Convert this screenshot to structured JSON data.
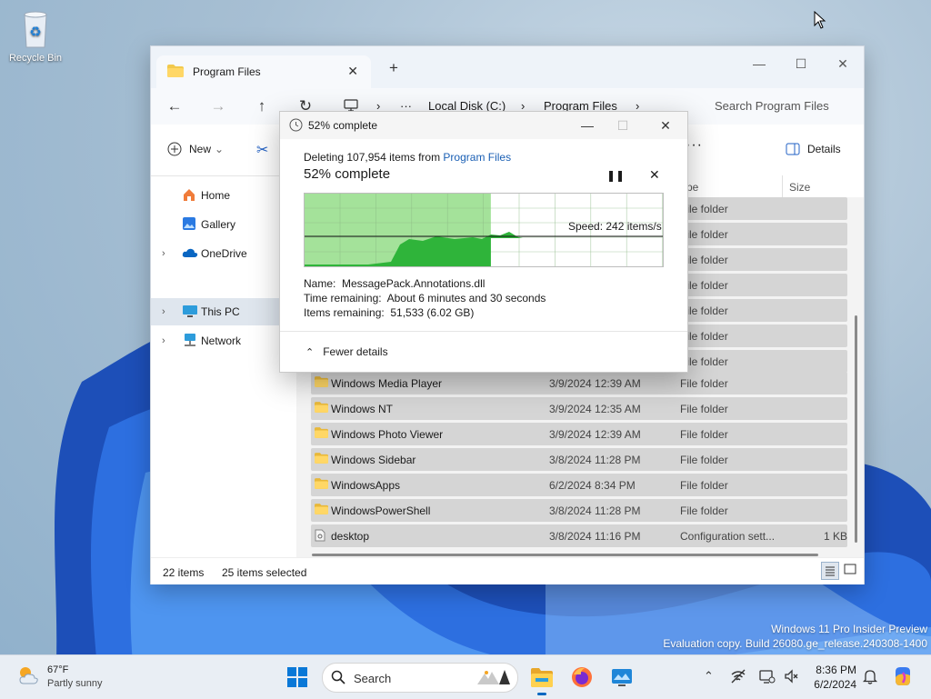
{
  "desktop": {
    "recycle_bin_label": "Recycle Bin",
    "watermark_line1": "Windows 11 Pro Insider Preview",
    "watermark_line2": "Evaluation copy. Build 26080.ge_release.240308-1400"
  },
  "explorer": {
    "tab_title": "Program Files",
    "tab_close": "✕",
    "new_tab": "+",
    "window_controls": {
      "minimize": "—",
      "maximize": "☐",
      "close": "✕"
    },
    "nav": {
      "back": "←",
      "forward": "→",
      "up": "↑",
      "refresh": "↻"
    },
    "breadcrumb": {
      "more": "···",
      "sep": "›",
      "items": [
        "Local Disk (C:)",
        "Program Files"
      ]
    },
    "search_placeholder": "Search Program Files",
    "toolbar": {
      "new_label": "New",
      "new_chevron": "⌄",
      "cut": "✂",
      "more": "···",
      "details_label": "Details"
    },
    "nav_pane": [
      {
        "label": "Home",
        "icon": "home-icon"
      },
      {
        "label": "Gallery",
        "icon": "gallery-icon"
      },
      {
        "label": "OneDrive",
        "icon": "onedrive-icon",
        "expandable": true
      },
      {
        "label": "This PC",
        "icon": "pc-icon",
        "expandable": true,
        "selected": true
      },
      {
        "label": "Network",
        "icon": "network-icon",
        "expandable": true
      }
    ],
    "chevron": "›",
    "columns": {
      "type": "ype",
      "size": "Size"
    },
    "hidden_rows_type": "File folder",
    "files": [
      {
        "name": "Windows Media Player",
        "date": "3/9/2024 12:39 AM",
        "type": "File folder",
        "size": ""
      },
      {
        "name": "Windows NT",
        "date": "3/9/2024 12:35 AM",
        "type": "File folder",
        "size": ""
      },
      {
        "name": "Windows Photo Viewer",
        "date": "3/9/2024 12:39 AM",
        "type": "File folder",
        "size": ""
      },
      {
        "name": "Windows Sidebar",
        "date": "3/8/2024 11:28 PM",
        "type": "File folder",
        "size": ""
      },
      {
        "name": "WindowsApps",
        "date": "6/2/2024 8:34 PM",
        "type": "File folder",
        "size": ""
      },
      {
        "name": "WindowsPowerShell",
        "date": "3/8/2024 11:28 PM",
        "type": "File folder",
        "size": ""
      },
      {
        "name": "desktop",
        "date": "3/8/2024 11:16 PM",
        "type": "Configuration sett...",
        "size": "1 KB"
      }
    ],
    "status": {
      "items": "22 items",
      "selected": "25 items selected"
    }
  },
  "dialog": {
    "title": "52% complete",
    "controls": {
      "minimize": "—",
      "maximize": "☐",
      "close": "✕"
    },
    "operation_prefix": "Deleting 107,954 items from ",
    "operation_target": "Program Files",
    "percent_label": "52% complete",
    "progress": 0.52,
    "pause": "❚❚",
    "cancel": "✕",
    "speed": "Speed: 242 items/s",
    "name_label": "Name:",
    "name_value": "MessagePack.Annotations.dll",
    "time_label": "Time remaining:",
    "time_value": "About 6 minutes and 30 seconds",
    "items_label": "Items remaining:",
    "items_value": "51,533 (6.02 GB)",
    "fewer_details": "Fewer details",
    "fewer_chevron": "⌃"
  },
  "taskbar": {
    "temp": "67°F",
    "condition": "Partly sunny",
    "search_label": "Search",
    "tray_chevron": "⌃",
    "time": "8:36 PM",
    "date": "6/2/2024"
  },
  "colors": {
    "accent": "#0067c0",
    "progress_fill": "#a4e29a",
    "graph_area": "#2fb43a",
    "link": "#1a5fb4"
  }
}
